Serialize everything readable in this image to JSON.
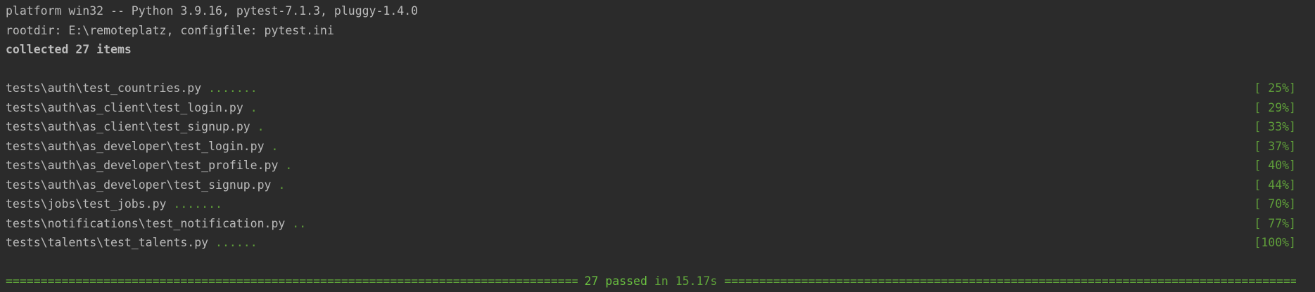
{
  "header": {
    "platform_line": "platform win32 -- Python 3.9.16, pytest-7.1.3, pluggy-1.4.0",
    "rootdir_line": "rootdir: E:\\remoteplatz, configfile: pytest.ini",
    "collected_line": "collected 27 items"
  },
  "results": [
    {
      "file": "tests\\auth\\test_countries.py",
      "dots": ".......",
      "percent": "[ 25%]"
    },
    {
      "file": "tests\\auth\\as_client\\test_login.py",
      "dots": ".",
      "percent": "[ 29%]"
    },
    {
      "file": "tests\\auth\\as_client\\test_signup.py",
      "dots": ".",
      "percent": "[ 33%]"
    },
    {
      "file": "tests\\auth\\as_developer\\test_login.py",
      "dots": ".",
      "percent": "[ 37%]"
    },
    {
      "file": "tests\\auth\\as_developer\\test_profile.py",
      "dots": ".",
      "percent": "[ 40%]"
    },
    {
      "file": "tests\\auth\\as_developer\\test_signup.py",
      "dots": ".",
      "percent": "[ 44%]"
    },
    {
      "file": "tests\\jobs\\test_jobs.py",
      "dots": ".......",
      "percent": "[ 70%]"
    },
    {
      "file": "tests\\notifications\\test_notification.py",
      "dots": "..",
      "percent": "[ 77%]"
    },
    {
      "file": "tests\\talents\\test_talents.py",
      "dots": "......",
      "percent": "[100%]"
    }
  ],
  "summary": {
    "passed": "27 passed",
    "duration": "in 15.17s"
  },
  "colors": {
    "background": "#2b2b2b",
    "text": "#bbbbbb",
    "success": "#5f9e3a"
  }
}
